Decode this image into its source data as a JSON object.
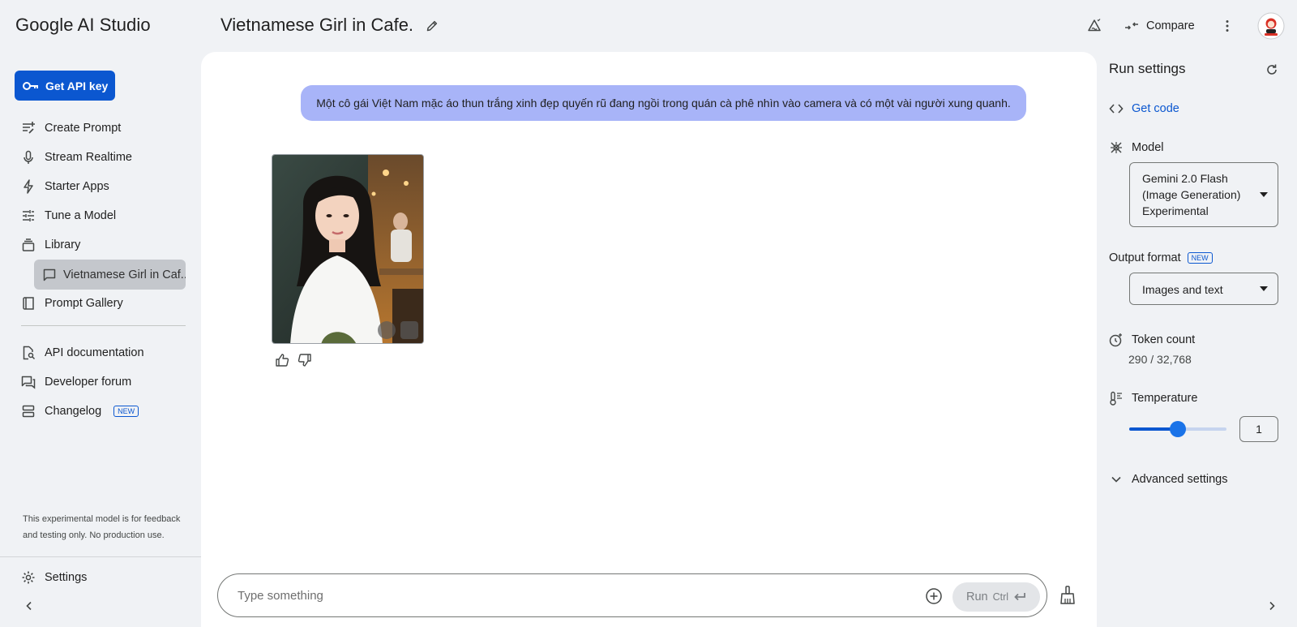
{
  "app": {
    "title": "Google AI Studio"
  },
  "sidebar": {
    "api_key_label": "Get API key",
    "items": [
      {
        "label": "Create Prompt",
        "icon": "create-prompt-icon"
      },
      {
        "label": "Stream Realtime",
        "icon": "microphone-icon"
      },
      {
        "label": "Starter Apps",
        "icon": "bolt-icon"
      },
      {
        "label": "Tune a Model",
        "icon": "tune-icon"
      },
      {
        "label": "Library",
        "icon": "library-icon"
      },
      {
        "label": "Prompt Gallery",
        "icon": "book-icon"
      },
      {
        "label": "API documentation",
        "icon": "doc-search-icon"
      },
      {
        "label": "Developer forum",
        "icon": "forum-icon"
      },
      {
        "label": "Changelog",
        "icon": "changelog-icon",
        "badge": "NEW"
      }
    ],
    "library_sub": {
      "label": "Vietnamese Girl in Caf..."
    },
    "disclaimer": "This experimental model is for feedback and testing only. No production use.",
    "settings_label": "Settings"
  },
  "header": {
    "prompt_title": "Vietnamese Girl in Cafe.",
    "compare_label": "Compare"
  },
  "chat": {
    "user_message": "Một cô gái Việt Nam mặc áo thun trắng xinh đẹp quyến rũ đang ngồi trong quán cà phê nhìn vào camera và có một vài người xung quanh.",
    "input_placeholder": "Type something",
    "run_label": "Run",
    "run_shortcut": "Ctrl"
  },
  "run_settings": {
    "title": "Run settings",
    "get_code_label": "Get code",
    "model_label": "Model",
    "model_value_lines": [
      "Gemini 2.0 Flash",
      "(Image Generation)",
      "Experimental"
    ],
    "output_format_label": "Output format",
    "output_format_badge": "NEW",
    "output_format_value": "Images and text",
    "token_count_label": "Token count",
    "token_count_value": "290 / 32,768",
    "temperature_label": "Temperature",
    "temperature_value": "1",
    "temperature_fraction": 0.5,
    "advanced_label": "Advanced settings"
  },
  "colors": {
    "accent": "#0b57d0",
    "user_bubble": "#a8b4f8",
    "background": "#f0f2f5"
  }
}
